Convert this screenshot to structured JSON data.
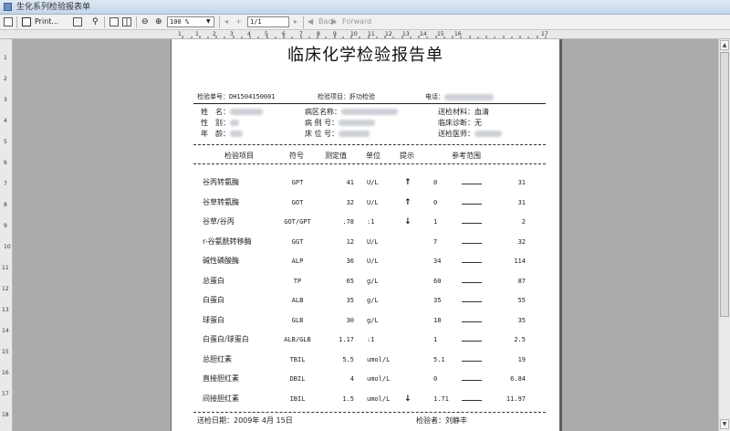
{
  "window": {
    "title": "生化系列检验报表单"
  },
  "toolbar": {
    "print_label": "Print...",
    "zoom_value": "100 %",
    "page_value": "1/1",
    "back_label": "Back",
    "forward_label": "Forward"
  },
  "ruler": {
    "top": [
      "1",
      "1",
      "2",
      "3",
      "4",
      "5",
      "6",
      "7",
      "8",
      "9",
      "10",
      "11",
      "12",
      "13",
      "14",
      "15",
      "16",
      "17"
    ],
    "left": [
      "1",
      "2",
      "3",
      "4",
      "5",
      "6",
      "7",
      "8",
      "9",
      "10",
      "11",
      "12",
      "13",
      "14",
      "15",
      "16",
      "17",
      "18"
    ]
  },
  "report": {
    "title": "临床化学检验报告单",
    "meta": {
      "sample_label": "检验单号：",
      "sample_value": "DH1504150001",
      "item_label": "检验项目：",
      "item_value": "肝功检验",
      "phone_label": "电话："
    },
    "patient": {
      "name_label": "姓　名：",
      "gender_label": "性　别：",
      "age_label": "年　龄：",
      "ward_label": "病区名称：",
      "case_label": "病 例 号：",
      "bed_label": "床 位 号：",
      "material_label": "送检材料：",
      "material_value": "血清",
      "diagnosis_label": "临床诊断：",
      "diagnosis_value": "无",
      "doctor_label": "送检医师："
    },
    "headers": {
      "item": "检验项目",
      "symbol": "符号",
      "value": "测定值",
      "unit": "单位",
      "hint": "提示",
      "range": "参考范围"
    },
    "rows": [
      {
        "name": "谷丙转氨酶",
        "code": "GPT",
        "value": "41",
        "unit": "U/L",
        "flag": "↑",
        "low": "0",
        "high": "31"
      },
      {
        "name": "谷草转氨酶",
        "code": "GOT",
        "value": "32",
        "unit": "U/L",
        "flag": "↑",
        "low": "0",
        "high": "31"
      },
      {
        "name": "谷草/谷丙",
        "code": "GOT/GPT",
        "value": ".78",
        "unit": ":1",
        "flag": "↓",
        "low": "1",
        "high": "2"
      },
      {
        "name": "r-谷氨酰转移酶",
        "code": "GGT",
        "value": "12",
        "unit": "U/L",
        "flag": "",
        "low": "7",
        "high": "32"
      },
      {
        "name": "碱性磷酸酶",
        "code": "ALP",
        "value": "36",
        "unit": "U/L",
        "flag": "",
        "low": "34",
        "high": "114"
      },
      {
        "name": "总蛋白",
        "code": "TP",
        "value": "65",
        "unit": "g/L",
        "flag": "",
        "low": "60",
        "high": "87"
      },
      {
        "name": "白蛋白",
        "code": "ALB",
        "value": "35",
        "unit": "g/L",
        "flag": "",
        "low": "35",
        "high": "55"
      },
      {
        "name": "球蛋白",
        "code": "GLB",
        "value": "30",
        "unit": "g/L",
        "flag": "",
        "low": "18",
        "high": "35"
      },
      {
        "name": "白蛋白/球蛋白",
        "code": "ALB/GLB",
        "value": "1.17",
        "unit": ":1",
        "flag": "",
        "low": "1",
        "high": "2.5"
      },
      {
        "name": "总胆红素",
        "code": "TBIL",
        "value": "5.5",
        "unit": "umol/L",
        "flag": "",
        "low": "5.1",
        "high": "19"
      },
      {
        "name": "直接胆红素",
        "code": "DBIL",
        "value": "4",
        "unit": "umol/L",
        "flag": "",
        "low": "0",
        "high": "6.84"
      },
      {
        "name": "间接胆红素",
        "code": "IBIL",
        "value": "1.5",
        "unit": "umol/L",
        "flag": "↓",
        "low": "1.71",
        "high": "11.97"
      }
    ],
    "footer": {
      "date_label": "送检日期：",
      "date_value": "2009年 4月 15日",
      "checker_label": "检验者：",
      "checker_value": "刘静丰"
    }
  }
}
